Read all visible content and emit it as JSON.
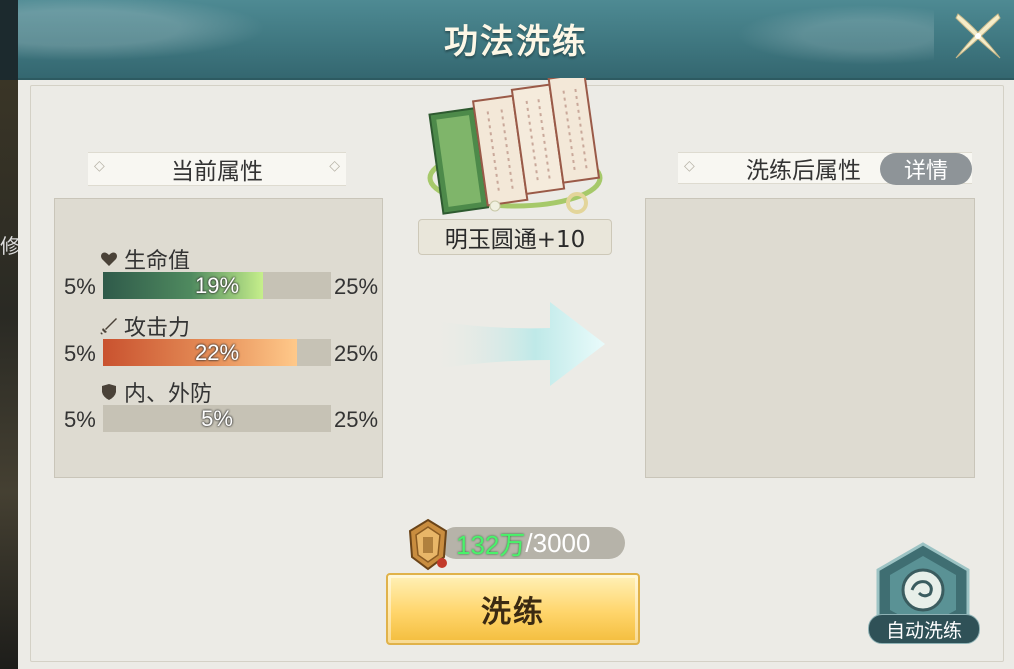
{
  "header": {
    "title": "功法洗练"
  },
  "background": {
    "side_text": "修"
  },
  "current_attrs": {
    "label": "当前属性",
    "items": [
      {
        "name": "生命值",
        "icon": "heart-icon",
        "min": "5%",
        "max": "25%",
        "value": "19%",
        "fraction": 0.19
      },
      {
        "name": "攻击力",
        "icon": "sword-icon",
        "min": "5%",
        "max": "25%",
        "value": "22%",
        "fraction": 0.22
      },
      {
        "name": "内、外防",
        "icon": "shield-icon",
        "min": "5%",
        "max": "25%",
        "value": "5%",
        "fraction": 0.05
      }
    ]
  },
  "after_attrs": {
    "label": "洗练后属性",
    "detail_button": "详情"
  },
  "technique": {
    "name": "明玉圆通+10"
  },
  "cost": {
    "have": "132万",
    "separator": "/",
    "need": "3000"
  },
  "actions": {
    "refine": "洗练",
    "auto_refine": "自动洗练"
  },
  "colors": {
    "header": "#3f7780",
    "panel": "#ecebe6",
    "button": "#ffd56b",
    "have_text": "#49f26a"
  }
}
